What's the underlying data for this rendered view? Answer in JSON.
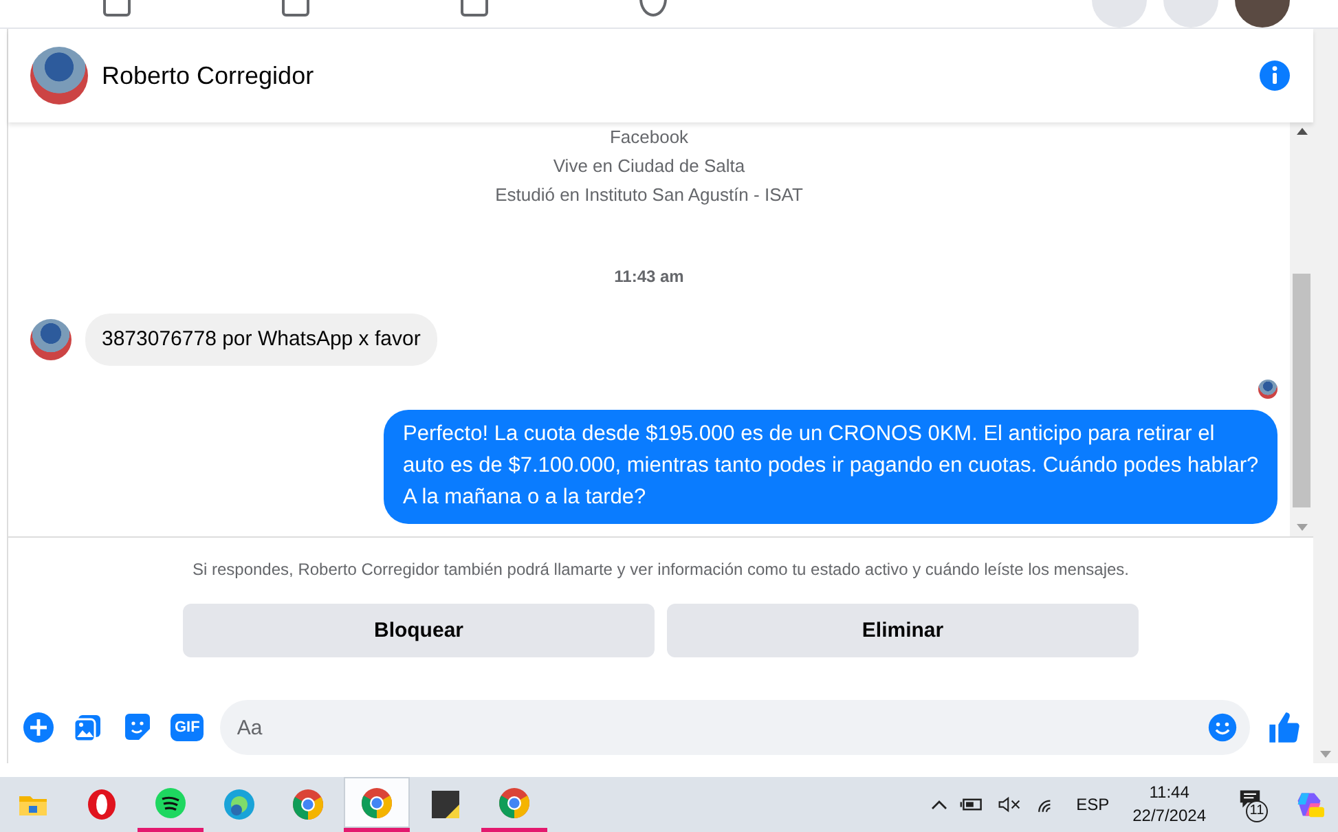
{
  "chat_header": {
    "name": "Roberto Corregidor"
  },
  "profile_intro": [
    "Facebook",
    "Vive en Ciudad de Salta",
    "Estudió en Instituto San Agustín - ISAT"
  ],
  "messages": [
    {
      "kind": "time",
      "text": "11:43 am"
    },
    {
      "kind": "incoming",
      "text": "3873076778 por WhatsApp x favor"
    },
    {
      "kind": "seen"
    },
    {
      "kind": "outgoing",
      "text": "Perfecto! La cuota desde $195.000 es de un CRONOS 0KM. El anticipo para retirar el auto es de $7.100.000, mientras tanto podes ir pagando en cuotas. Cuándo podes hablar? A la mañana o a la tarde?"
    }
  ],
  "notice": "Si respondes, Roberto Corregidor también podrá llamarte y ver información como tu estado activo y cuándo leíste los mensajes.",
  "buttons": [
    "Bloquear",
    "Eliminar"
  ],
  "composer": {
    "gif_label": "GIF",
    "placeholder": "Aa"
  },
  "taskbar": {
    "apps": [
      {
        "kind": "folder",
        "running": false,
        "selected": false
      },
      {
        "kind": "opera",
        "running": false,
        "selected": false
      },
      {
        "kind": "spotify",
        "running": true,
        "selected": false
      },
      {
        "kind": "edge",
        "running": false,
        "selected": false
      },
      {
        "kind": "chrome",
        "running": false,
        "selected": false
      },
      {
        "kind": "chrome",
        "running": true,
        "selected": true
      },
      {
        "kind": "notes",
        "running": false,
        "selected": false
      },
      {
        "kind": "chrome",
        "running": true,
        "selected": false
      }
    ],
    "language": "ESP",
    "time": "11:44",
    "date": "22/7/2024",
    "notification_count": "11"
  }
}
